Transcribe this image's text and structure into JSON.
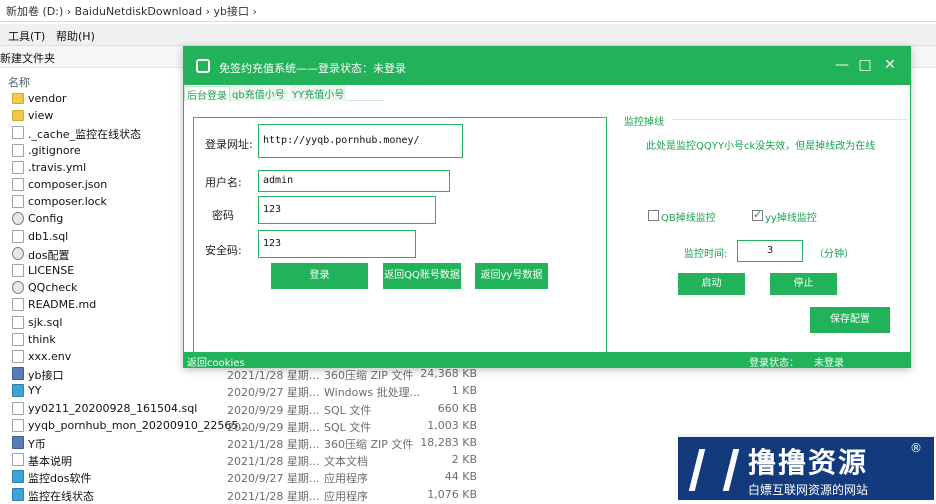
{
  "explorer": {
    "address": "新加卷 (D:)  ›  BaiduNetdiskDownload  ›  yb接口  ›",
    "menu": [
      "工具(T)",
      "帮助(H)"
    ],
    "toolbar_label": "新建文件夹",
    "column_name": "名称",
    "files": [
      {
        "name": "vendor",
        "icon": "folder-icon",
        "date": "",
        "type": "",
        "size": ""
      },
      {
        "name": "view",
        "icon": "folder-icon",
        "date": "",
        "type": "",
        "size": ""
      },
      {
        "name": "._cache_监控在线状态",
        "icon": "file-icon",
        "date": "",
        "type": "",
        "size": ""
      },
      {
        "name": ".gitignore",
        "icon": "file-icon",
        "date": "",
        "type": "",
        "size": ""
      },
      {
        "name": ".travis.yml",
        "icon": "file-icon",
        "date": "",
        "type": "",
        "size": ""
      },
      {
        "name": "composer.json",
        "icon": "file-icon",
        "date": "",
        "type": "",
        "size": ""
      },
      {
        "name": "composer.lock",
        "icon": "file-icon",
        "date": "",
        "type": "",
        "size": ""
      },
      {
        "name": "Config",
        "icon": "gear-icon",
        "date": "",
        "type": "",
        "size": ""
      },
      {
        "name": "db1.sql",
        "icon": "file-icon",
        "date": "",
        "type": "",
        "size": ""
      },
      {
        "name": "dos配置",
        "icon": "gear-icon",
        "date": "",
        "type": "",
        "size": ""
      },
      {
        "name": "LICENSE",
        "icon": "file-icon",
        "date": "",
        "type": "",
        "size": ""
      },
      {
        "name": "QQcheck",
        "icon": "gear-icon",
        "date": "",
        "type": "",
        "size": ""
      },
      {
        "name": "README.md",
        "icon": "file-icon",
        "date": "",
        "type": "",
        "size": ""
      },
      {
        "name": "sjk.sql",
        "icon": "file-icon",
        "date": "",
        "type": "",
        "size": ""
      },
      {
        "name": "think",
        "icon": "file-icon",
        "date": "",
        "type": "",
        "size": ""
      },
      {
        "name": "xxx.env",
        "icon": "file-icon",
        "date": "",
        "type": "",
        "size": ""
      },
      {
        "name": "yb接口",
        "icon": "zip-icon",
        "date": "2021/1/28 星期...",
        "type": "360压缩 ZIP 文件",
        "size": "24,368 KB"
      },
      {
        "name": "YY",
        "icon": "exe-icon",
        "date": "2020/9/27 星期...",
        "type": "Windows 批处理...",
        "size": "1 KB"
      },
      {
        "name": "yy0211_20200928_161504.sql",
        "icon": "file-icon",
        "date": "2020/9/29 星期...",
        "type": "SQL 文件",
        "size": "660 KB"
      },
      {
        "name": "yyqb_pornhub_mon_20200910_22565...",
        "icon": "file-icon",
        "date": "2020/9/29 星期...",
        "type": "SQL 文件",
        "size": "1,003 KB"
      },
      {
        "name": "Y币",
        "icon": "zip-icon",
        "date": "2021/1/28 星期...",
        "type": "360压缩 ZIP 文件",
        "size": "18,283 KB"
      },
      {
        "name": "基本说明",
        "icon": "file-icon",
        "date": "2021/1/28 星期...",
        "type": "文本文档",
        "size": "2 KB"
      },
      {
        "name": "监控dos软件",
        "icon": "exe-icon",
        "date": "2020/9/27 星期...",
        "type": "应用程序",
        "size": "44 KB"
      },
      {
        "name": "监控在线状态",
        "icon": "exe-icon",
        "date": "2021/1/28 星期...",
        "type": "应用程序",
        "size": "1,076 KB"
      }
    ]
  },
  "app": {
    "title": "免签约充值系统——登录状态：未登录",
    "window_controls": [
      "✕",
      "□",
      "—"
    ],
    "tabs": [
      "后台登录",
      "qb充值小号",
      "YY充值小号"
    ],
    "login": {
      "url_label": "登录网址:",
      "url_value": "http://yyqb.pornhub.money/",
      "user_label": "用户名:",
      "user_value": "admin",
      "password_label": "密码",
      "password_value": "123",
      "code_label": "安全码:",
      "code_value": "123",
      "btn_login": "登录",
      "btn_qq_data": "返回QQ账号数据",
      "btn_yy_data": "返回yy号数据"
    },
    "monitor": {
      "section_title": "监控掉线",
      "note": "此处是监控QQYY小号ck没失效，但是掉线改为在线",
      "qb_label": "QB掉线监控",
      "qb_checked": false,
      "yy_label": "yy掉线监控",
      "yy_checked": true,
      "time_label": "监控时间:",
      "time_value": "3",
      "time_unit": "（分钟）",
      "btn_start": "启动",
      "btn_stop": "停止",
      "btn_save": "保存配置"
    },
    "status": {
      "cookies_link": "返回cookies",
      "label": "登录状态：",
      "value": "未登录"
    }
  },
  "watermark": {
    "big": "撸撸资源",
    "small": "白嫖互联网资源的网站",
    "reg": "®"
  }
}
